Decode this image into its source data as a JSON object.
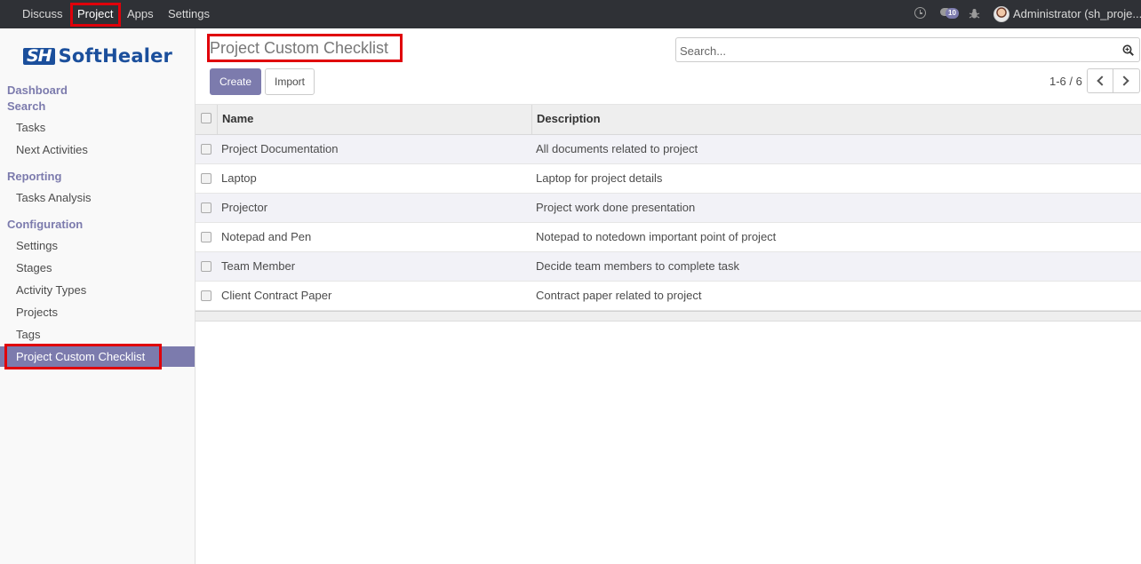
{
  "topbar": {
    "menu": [
      "Discuss",
      "Project",
      "Apps",
      "Settings"
    ],
    "active": "Project",
    "chat_badge": "10",
    "user": "Administrator (sh_proje..."
  },
  "sidebar": {
    "logo_mark": "SH",
    "logo_text": "SoftHealer",
    "sections": {
      "dashboard": "Dashboard",
      "search": "Search",
      "reporting": "Reporting",
      "configuration": "Configuration"
    },
    "items": {
      "tasks": "Tasks",
      "next_activities": "Next Activities",
      "tasks_analysis": "Tasks Analysis",
      "settings": "Settings",
      "stages": "Stages",
      "activity_types": "Activity Types",
      "projects": "Projects",
      "tags": "Tags",
      "project_custom_checklist": "Project Custom Checklist"
    }
  },
  "control": {
    "title": "Project Custom Checklist",
    "create_label": "Create",
    "import_label": "Import",
    "search_placeholder": "Search...",
    "pager": "1-6 / 6"
  },
  "table": {
    "columns": [
      "Name",
      "Description"
    ],
    "rows": [
      {
        "name": "Project Documentation",
        "description": "All documents related to project"
      },
      {
        "name": "Laptop",
        "description": "Laptop for project details"
      },
      {
        "name": "Projector",
        "description": "Project work done presentation"
      },
      {
        "name": "Notepad and Pen",
        "description": "Notepad to notedown important point of project"
      },
      {
        "name": "Team Member",
        "description": "Decide team members to complete task"
      },
      {
        "name": "Client Contract Paper",
        "description": "Contract paper related to project"
      }
    ]
  },
  "colors": {
    "accent": "#7c7bad",
    "highlight_box": "#e0000a",
    "topbar_bg": "#2f3136"
  }
}
